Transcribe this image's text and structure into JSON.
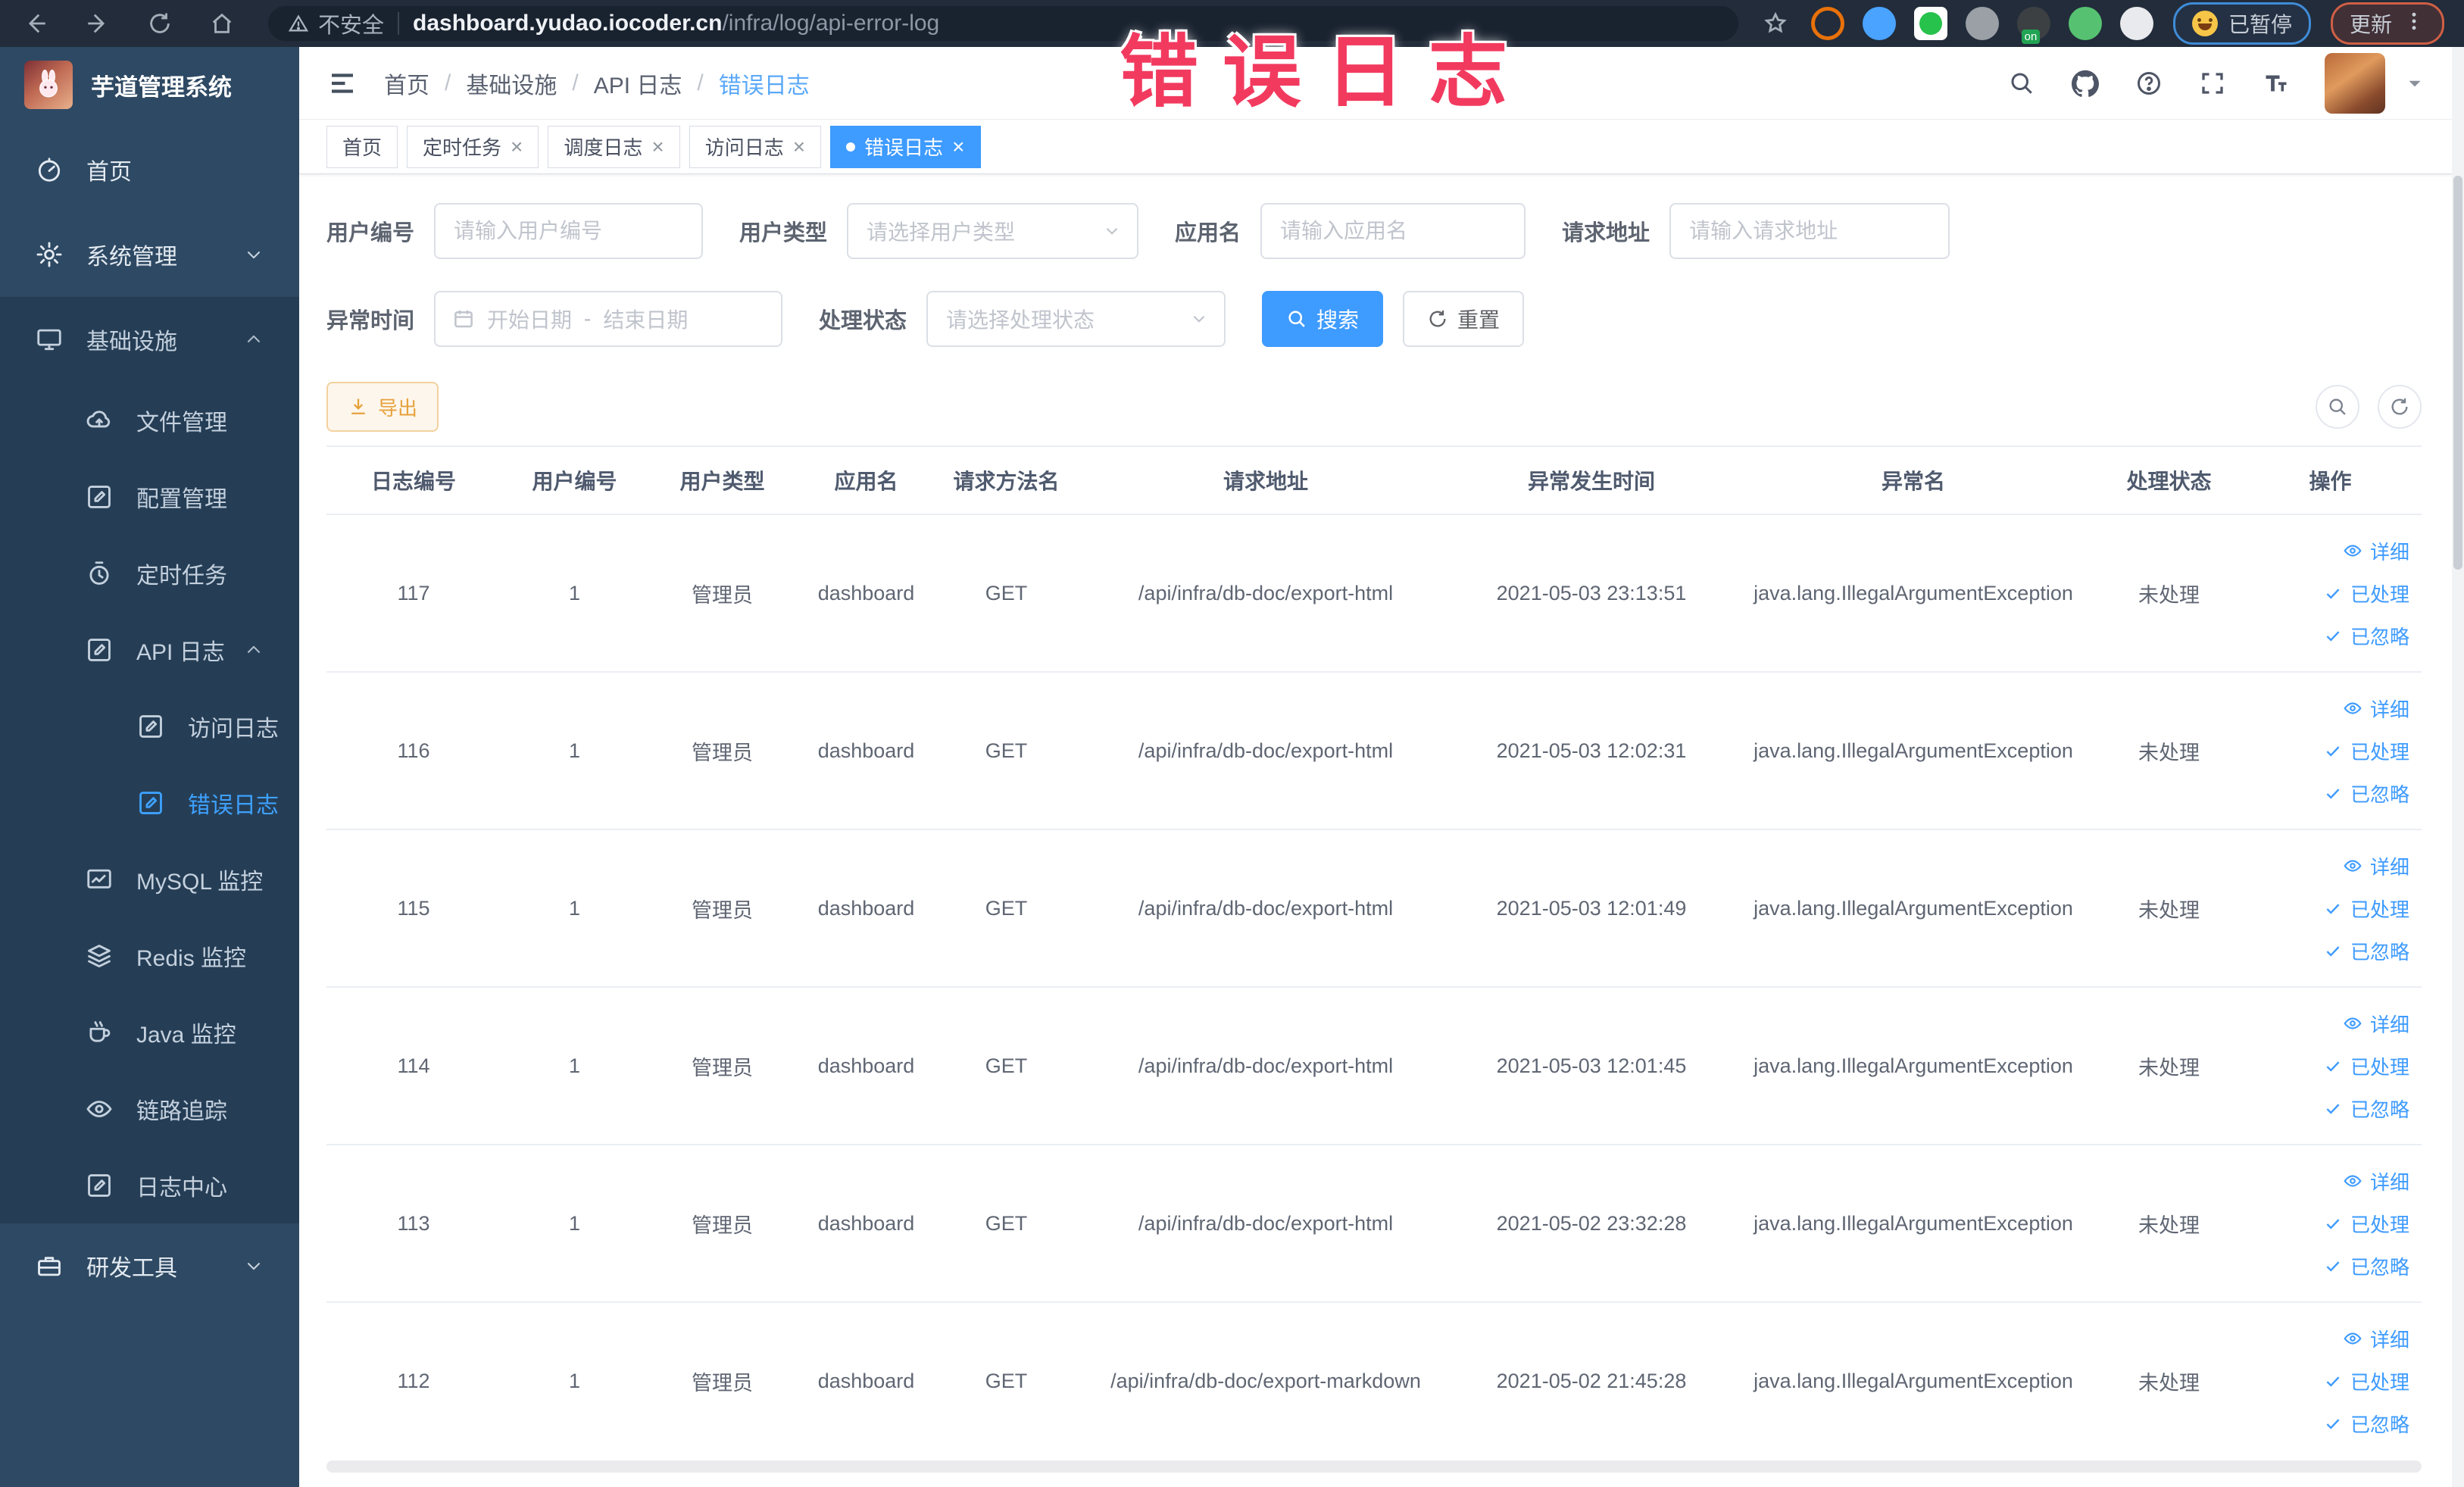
{
  "annotation": {
    "text": "错误日志",
    "color": "#f23a5f"
  },
  "browser": {
    "security_label": "不安全",
    "url_host": "dashboard.yudao.iocoder.cn",
    "url_path": "/infra/log/api-error-log",
    "paused_label": "已暂停",
    "update_label": "更新",
    "extensions": [
      {
        "key": "target",
        "color": "#e8710a",
        "style": "ring"
      },
      {
        "key": "shield",
        "color": "#4aa3ff",
        "style": "solid"
      },
      {
        "key": "v-green",
        "color": "#27c24c",
        "style": "boxed"
      },
      {
        "key": "grid",
        "color": "#9aa0a6",
        "style": "solid"
      },
      {
        "key": "list-on",
        "color": "#3c4043",
        "style": "solid",
        "badge": "on"
      },
      {
        "key": "leaf",
        "color": "#56c271",
        "style": "solid"
      },
      {
        "key": "puzzle",
        "color": "#e8eaed",
        "style": "solid"
      }
    ]
  },
  "sidebar": {
    "title": "芋道管理系统",
    "items": [
      {
        "key": "home",
        "label": "首页",
        "icon": "dashboard",
        "level": 1
      },
      {
        "key": "system-management",
        "label": "系统管理",
        "icon": "gear",
        "level": 1,
        "arrow": "down"
      },
      {
        "key": "infrastructure",
        "label": "基础设施",
        "icon": "monitor",
        "level": 1,
        "arrow": "up",
        "open": true
      },
      {
        "key": "file-management",
        "label": "文件管理",
        "icon": "cloud",
        "level": 2
      },
      {
        "key": "config-management",
        "label": "配置管理",
        "icon": "edit",
        "level": 2
      },
      {
        "key": "scheduled-tasks",
        "label": "定时任务",
        "icon": "timer",
        "level": 2
      },
      {
        "key": "api-log",
        "label": "API 日志",
        "icon": "edit",
        "level": 2,
        "arrow": "up",
        "open": true
      },
      {
        "key": "access-log",
        "label": "访问日志",
        "icon": "edit",
        "level": 3
      },
      {
        "key": "error-log",
        "label": "错误日志",
        "icon": "edit",
        "level": 3,
        "active": true
      },
      {
        "key": "mysql-monitor",
        "label": "MySQL 监控",
        "icon": "chart",
        "level": 2
      },
      {
        "key": "redis-monitor",
        "label": "Redis 监控",
        "icon": "layers",
        "level": 2
      },
      {
        "key": "java-monitor",
        "label": "Java 监控",
        "icon": "coffee",
        "level": 2
      },
      {
        "key": "trace",
        "label": "链路追踪",
        "icon": "eye",
        "level": 2
      },
      {
        "key": "log-center",
        "label": "日志中心",
        "icon": "edit",
        "level": 2
      },
      {
        "key": "dev-tools",
        "label": "研发工具",
        "icon": "toolbox",
        "level": 1,
        "arrow": "down"
      }
    ]
  },
  "header": {
    "breadcrumb": [
      "首页",
      "基础设施",
      "API 日志",
      "错误日志"
    ]
  },
  "tabs": [
    {
      "key": "home",
      "label": "首页",
      "closable": false,
      "active": false
    },
    {
      "key": "scheduled-tasks",
      "label": "定时任务",
      "closable": true,
      "active": false
    },
    {
      "key": "schedule-log",
      "label": "调度日志",
      "closable": true,
      "active": false
    },
    {
      "key": "access-log",
      "label": "访问日志",
      "closable": true,
      "active": false
    },
    {
      "key": "error-log",
      "label": "错误日志",
      "closable": true,
      "active": true
    }
  ],
  "filters": {
    "user_id": {
      "label": "用户编号",
      "placeholder": "请输入用户编号"
    },
    "user_type": {
      "label": "用户类型",
      "placeholder": "请选择用户类型"
    },
    "app_name": {
      "label": "应用名",
      "placeholder": "请输入应用名"
    },
    "request_url": {
      "label": "请求地址",
      "placeholder": "请输入请求地址"
    },
    "time_range": {
      "label": "异常时间",
      "start_placeholder": "开始日期",
      "separator": "-",
      "end_placeholder": "结束日期"
    },
    "status": {
      "label": "处理状态",
      "placeholder": "请选择处理状态"
    },
    "search_label": "搜索",
    "reset_label": "重置"
  },
  "toolbar": {
    "export_label": "导出"
  },
  "table": {
    "columns": [
      "日志编号",
      "用户编号",
      "用户类型",
      "应用名",
      "请求方法名",
      "请求地址",
      "异常发生时间",
      "异常名",
      "处理状态",
      "操作"
    ],
    "row_actions": [
      {
        "key": "detail",
        "label": "详细",
        "icon": "eye"
      },
      {
        "key": "processed",
        "label": "已处理",
        "icon": "check"
      },
      {
        "key": "ignored",
        "label": "已忽略",
        "icon": "check"
      }
    ],
    "rows": [
      {
        "id": "117",
        "user_id": "1",
        "user_type": "管理员",
        "app": "dashboard",
        "method": "GET",
        "url": "/api/infra/db-doc/export-html",
        "time": "2021-05-03 23:13:51",
        "exception": "java.lang.IllegalArgumentException",
        "status": "未处理"
      },
      {
        "id": "116",
        "user_id": "1",
        "user_type": "管理员",
        "app": "dashboard",
        "method": "GET",
        "url": "/api/infra/db-doc/export-html",
        "time": "2021-05-03 12:02:31",
        "exception": "java.lang.IllegalArgumentException",
        "status": "未处理"
      },
      {
        "id": "115",
        "user_id": "1",
        "user_type": "管理员",
        "app": "dashboard",
        "method": "GET",
        "url": "/api/infra/db-doc/export-html",
        "time": "2021-05-03 12:01:49",
        "exception": "java.lang.IllegalArgumentException",
        "status": "未处理"
      },
      {
        "id": "114",
        "user_id": "1",
        "user_type": "管理员",
        "app": "dashboard",
        "method": "GET",
        "url": "/api/infra/db-doc/export-html",
        "time": "2021-05-03 12:01:45",
        "exception": "java.lang.IllegalArgumentException",
        "status": "未处理"
      },
      {
        "id": "113",
        "user_id": "1",
        "user_type": "管理员",
        "app": "dashboard",
        "method": "GET",
        "url": "/api/infra/db-doc/export-html",
        "time": "2021-05-02 23:32:28",
        "exception": "java.lang.IllegalArgumentException",
        "status": "未处理"
      },
      {
        "id": "112",
        "user_id": "1",
        "user_type": "管理员",
        "app": "dashboard",
        "method": "GET",
        "url": "/api/infra/db-doc/export-markdown",
        "time": "2021-05-02 21:45:28",
        "exception": "java.lang.IllegalArgumentException",
        "status": "未处理"
      }
    ]
  }
}
